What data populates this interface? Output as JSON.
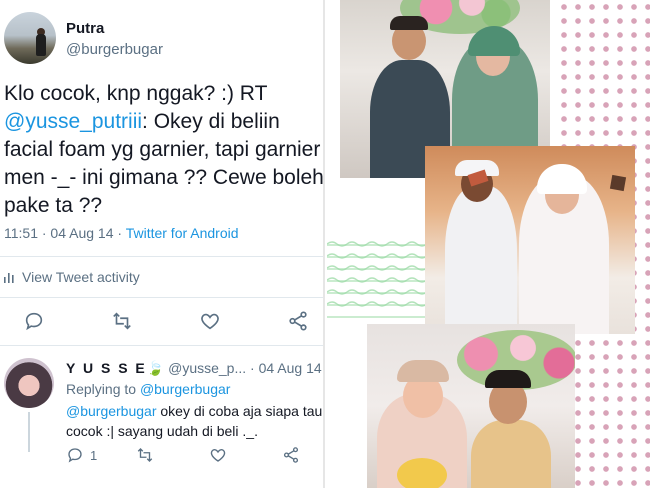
{
  "tweet": {
    "author_name": "Putra",
    "author_handle": "@burgerbugar",
    "text_prefix": "Klo cocok, knp nggak? :) RT ",
    "text_mention": "@yusse_putriii",
    "text_suffix": ": Okey di beliin facial foam yg garnier, tapi garnier men -_- ini gimana ?? Cewe boleh pake ta ??",
    "time": "11:51 · 04 Aug 14 · ",
    "source": "Twitter for Android",
    "activity_label": "View Tweet activity",
    "icons": [
      "reply-icon",
      "retweet-icon",
      "like-icon",
      "share-icon"
    ]
  },
  "reply": {
    "name": "Y U S S E",
    "emoji": "🍃",
    "handle": "@yusse_p...",
    "date": "· 04 Aug 14",
    "replying_label": "Replying to ",
    "replying_to": "@burgerbugar",
    "text_mention": "@burgerbugar",
    "text": " okey di coba aja siapa tau cocok :| sayang udah di beli ._.",
    "reply_count": "1",
    "icons": [
      "reply-icon",
      "retweet-icon",
      "like-icon",
      "share-icon"
    ]
  },
  "collage": {
    "photos": [
      "wedding-photo-1",
      "wedding-photo-2",
      "wedding-photo-3"
    ],
    "accent_dots": "#d8a3b8",
    "accent_waves": "#a0dcaa"
  }
}
